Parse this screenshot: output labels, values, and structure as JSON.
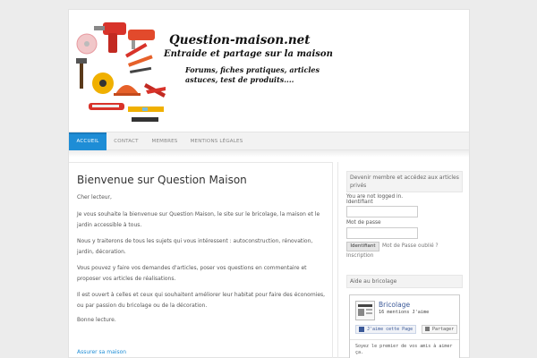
{
  "header": {
    "site_title": "Question-maison.net",
    "tagline": "Entraide et partage sur la maison",
    "description": "Forums, fiches pratiques, articles astuces, test de produits...."
  },
  "nav": {
    "items": [
      {
        "label": "Accueil",
        "active": true
      },
      {
        "label": "Contact",
        "active": false
      },
      {
        "label": "Membres",
        "active": false
      },
      {
        "label": "Mentions légales",
        "active": false
      }
    ]
  },
  "content": {
    "title": "Bienvenue sur Question Maison",
    "paragraphs": [
      "Cher lecteur,",
      "Je vous souhaite la bienvenue sur Question Maison, le site sur le bricolage, la maison et le jardin accessible à tous.",
      "Nous y traiterons de tous les sujets qui vous intéressent : autoconstruction, rénovation, jardin, décoration.",
      "Vous pouvez y faire vos demandes d'articles, poser vos questions en commentaire et proposer vos articles de réalisations.",
      "Il est ouvert à celles et ceux qui souhaitent améliorer leur habitat pour faire des économies, ou par passion du bricolage ou de la décoration.",
      "Bonne lecture."
    ],
    "link": "Assurer sa maison"
  },
  "sidebar": {
    "login_title": "Devenir membre et accédez aux articles privés",
    "not_logged": "You are not logged in.",
    "username_label": "Identifiant",
    "password_label": "Mot de passe",
    "login_button": "Identifiant",
    "lost_password": "Mot de Passe oublié ?",
    "register": "Inscription",
    "help_title": "Aide au bricolage",
    "fb_page_name": "Bricolage",
    "fb_likes": "16 mentions J'aime",
    "fb_like_button": "J'aime cette Page",
    "fb_share_button": "Partager",
    "fb_friends_text": "Soyez le premier de vos amis à aimer ça."
  },
  "colors": {
    "accent": "#1e8dd6",
    "facebook": "#3b5998"
  }
}
